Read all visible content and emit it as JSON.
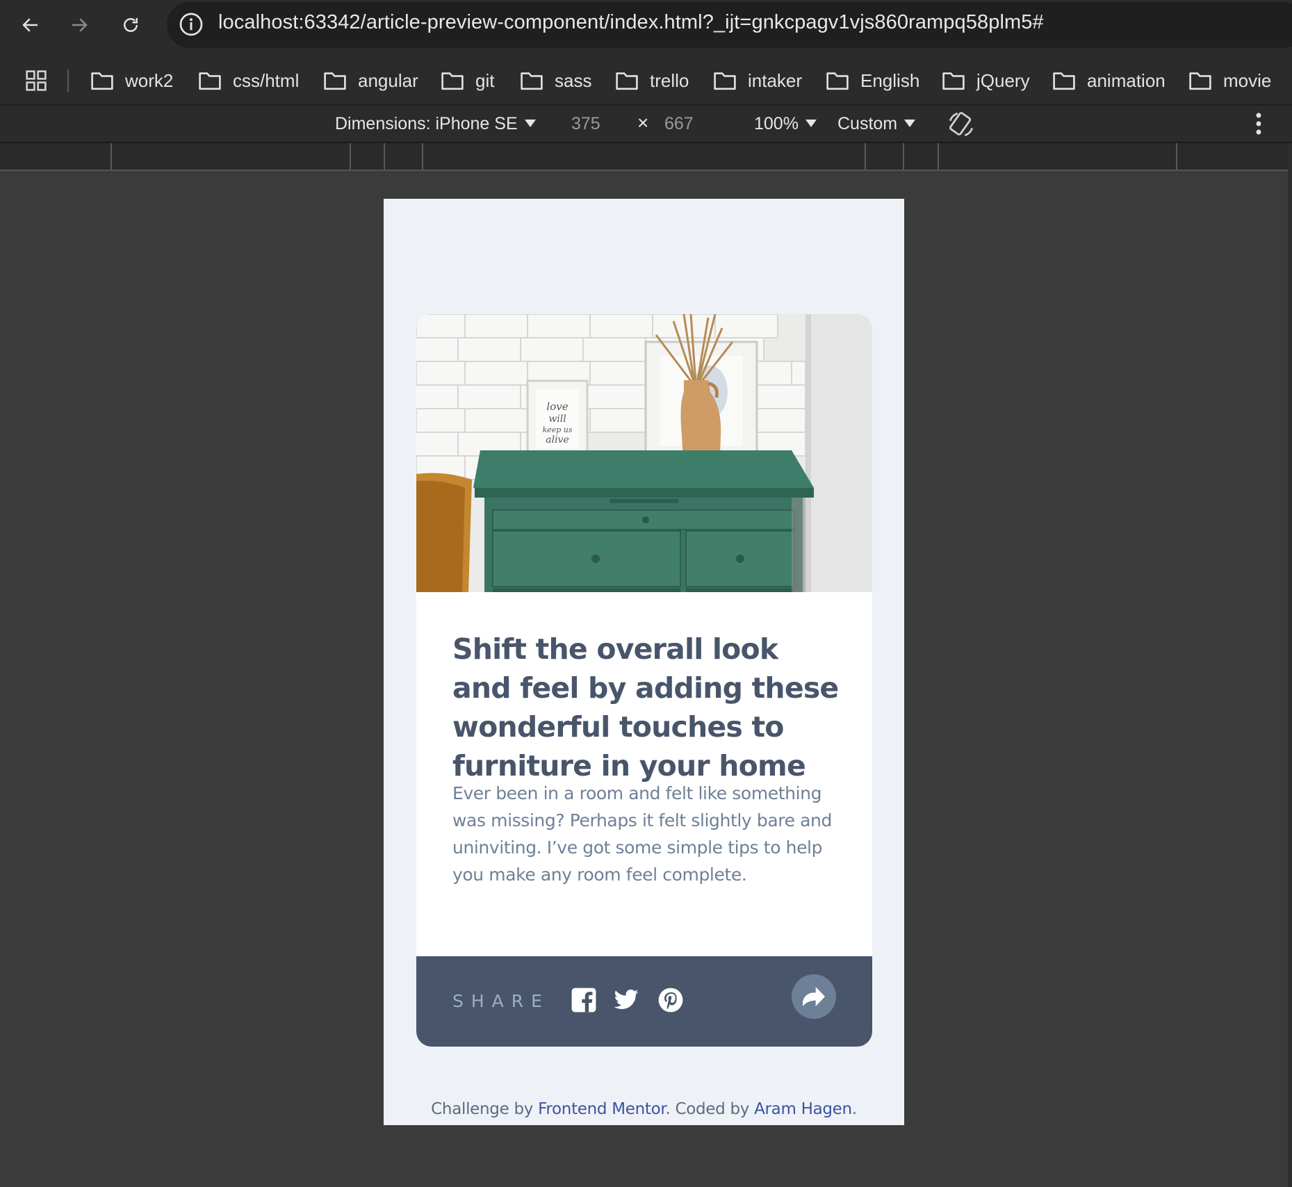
{
  "browser": {
    "url": "localhost:63342/article-preview-component/index.html?_ijt=gnkcpagv1vjs860rampq58plm5#",
    "icons": {
      "back": "arrow-left-icon",
      "forward": "arrow-right-icon",
      "reload": "reload-icon",
      "info": "info-icon"
    },
    "bookmarks": [
      "work2",
      "css/html",
      "angular",
      "git",
      "sass",
      "trello",
      "intaker",
      "English",
      "jQuery",
      "animation",
      "movie"
    ]
  },
  "devtools": {
    "dimensions_label": "Dimensions: iPhone SE",
    "width_value": "375",
    "times": "×",
    "height_value": "667",
    "zoom": "100%",
    "throttle": "Custom"
  },
  "card": {
    "title": "Shift the overall look and feel by adding these wonderful touches to furniture in your home",
    "description": "Ever been in a room and felt like something was missing? Perhaps it felt slightly bare and uninviting. I’ve got some simple tips to help you make any room feel complete.",
    "share_label": "SHARE",
    "social_icons": [
      "facebook-icon",
      "twitter-icon",
      "pinterest-icon"
    ],
    "share_icon": "share-arrow-icon"
  },
  "attribution": {
    "prefix": "Challenge by ",
    "link1": "Frontend Mentor",
    "middle": ". Coded by ",
    "link2": "Aram Hagen",
    "suffix": "."
  },
  "colors": {
    "title": "#48556a",
    "description": "#6e8098",
    "share_bar": "#48556a",
    "share_button": "#6e8098",
    "page_bg": "#eef2f6",
    "link": "#3e52a3"
  }
}
